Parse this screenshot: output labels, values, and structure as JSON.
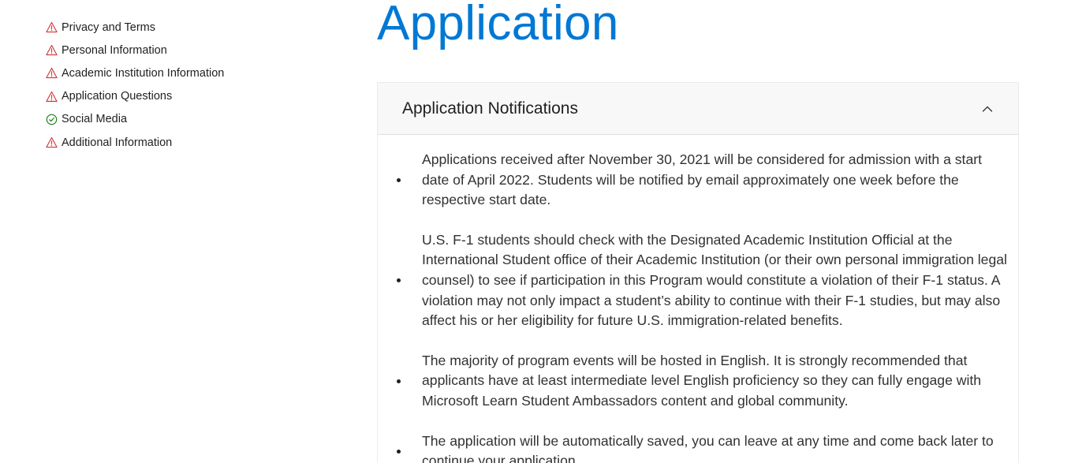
{
  "sidebar": {
    "items": [
      {
        "label": "Privacy and Terms",
        "status": "warning"
      },
      {
        "label": "Personal Information",
        "status": "warning"
      },
      {
        "label": "Academic Institution Information",
        "status": "warning"
      },
      {
        "label": "Application Questions",
        "status": "warning"
      },
      {
        "label": "Social Media",
        "status": "complete"
      },
      {
        "label": "Additional Information",
        "status": "warning"
      }
    ]
  },
  "icons": {
    "warning": "warning-triangle-icon",
    "complete": "check-circle-icon",
    "collapse": "chevron-up-icon"
  },
  "colors": {
    "accent": "#0078d4",
    "warning": "#d13438",
    "complete": "#107c10"
  },
  "main": {
    "title": "Application",
    "panel": {
      "title": "Application Notifications",
      "notices": [
        "Applications received after November 30, 2021 will be considered for admission with a start date of April 2022. Students will be notified by email approximately one week before the respective start date.",
        "U.S. F-1 students should check with the Designated Academic Institution Official at the International Student office of their Academic Institution (or their own personal immigration legal counsel) to see if participation in this Program would constitute a violation of their F-1 status. A violation may not only impact a student’s ability to continue with their F-1 studies, but may also affect his or her eligibility for future U.S. immigration-related benefits.",
        "The majority of program events will be hosted in English. It is strongly recommended that applicants have at least intermediate level English proficiency so they can fully engage with Microsoft Learn Student Ambassadors content and global community.",
        "The application will be automatically saved, you can leave at any time and come back later to continue your application."
      ]
    }
  }
}
